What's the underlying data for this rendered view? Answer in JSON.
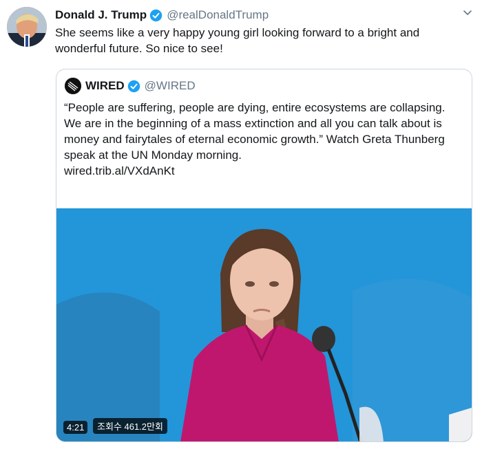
{
  "tweet": {
    "author_name": "Donald J. Trump",
    "author_handle": "@realDonaldTrump",
    "text": "She seems like a very happy young girl looking forward to a bright and wonderful future. So nice to see!"
  },
  "quote": {
    "author_name": "WIRED",
    "author_handle": "@WIRED",
    "text": "“People are suffering, people are dying, entire ecosystems are collapsing. We are in the beginning of a mass extinction and all you can talk about is money and fairytales of eternal economic growth.” Watch Greta Thunberg speak at the UN Monday morning.",
    "link": "wired.trib.al/VXdAnKt"
  },
  "video": {
    "duration": "4:21",
    "views": "조회수 461.2만회"
  },
  "colors": {
    "verified": "#1da1f2",
    "handle": "#657786",
    "video_background": "#1f8ed3",
    "shirt": "#c0176e"
  },
  "icons": [
    "verified-icon",
    "caret-down-icon",
    "wired-logo"
  ]
}
